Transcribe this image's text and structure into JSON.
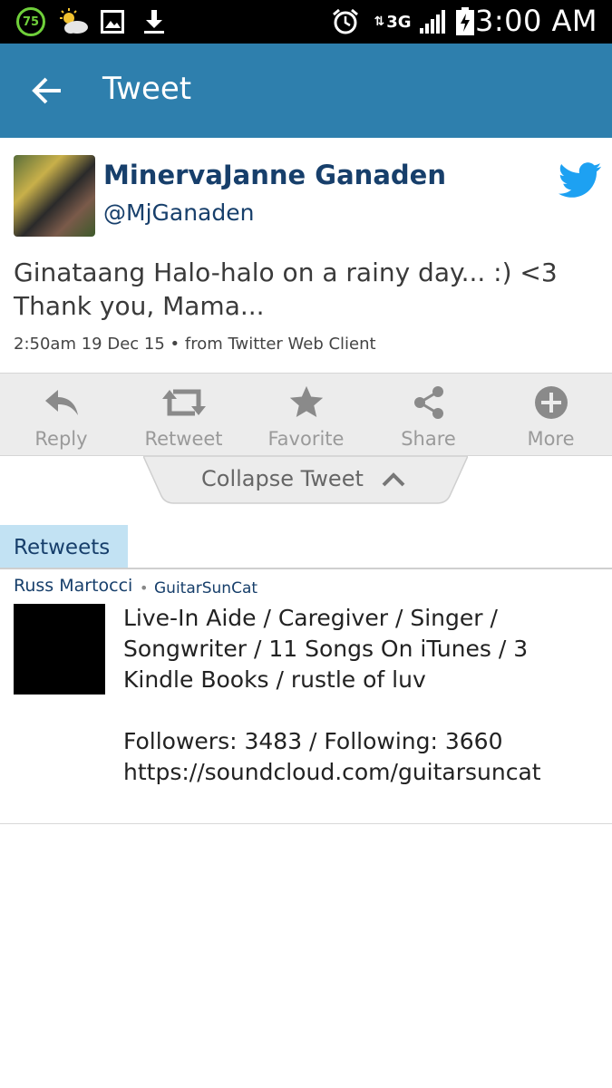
{
  "status_bar": {
    "battery_level": "75",
    "network": "3G",
    "time": "3:00 AM",
    "icons": [
      "battery-ring-icon",
      "weather-icon",
      "gallery-icon",
      "download-icon",
      "alarm-icon",
      "data-arrows-icon",
      "signal-icon",
      "battery-icon"
    ]
  },
  "action_bar": {
    "title": "Tweet",
    "back_icon": "back-arrow-icon",
    "color": "#2e7fad"
  },
  "tweet": {
    "display_name": "MinervaJanne Ganaden",
    "handle": "@MjGanaden",
    "text": "Ginataang Halo-halo on a rainy day... :) <3 Thank you, Mama...",
    "meta": "2:50am 19 Dec 15 • from Twitter Web Client",
    "brand_icon": "twitter-bird-icon",
    "brand_color": "#1da1f2"
  },
  "toolbar": {
    "items": [
      {
        "label": "Reply",
        "icon": "reply-icon"
      },
      {
        "label": "Retweet",
        "icon": "retweet-icon"
      },
      {
        "label": "Favorite",
        "icon": "star-icon"
      },
      {
        "label": "Share",
        "icon": "share-icon"
      },
      {
        "label": "More",
        "icon": "plus-circle-icon"
      }
    ]
  },
  "collapse": {
    "label": "Collapse Tweet",
    "icon": "chevron-up-icon"
  },
  "retweets": {
    "tab_label": "Retweets",
    "tab_color": "#c2e2f3",
    "items": [
      {
        "name": "Russ Martocci",
        "separator": "•",
        "handle": "GuitarSunCat",
        "bio_lines": [
          "Live-In Aide / Caregiver / Singer / Songwriter / 11 Songs On iTunes / 3 Kindle Books / rustle of luv",
          "Followers: 3483 / Following: 3660 https://soundcloud.com/guitarsuncat"
        ]
      }
    ]
  },
  "colors": {
    "name_blue": "#173f6b",
    "toolbar_gray": "#ececec",
    "toolbar_label": "#9a9a9a"
  }
}
